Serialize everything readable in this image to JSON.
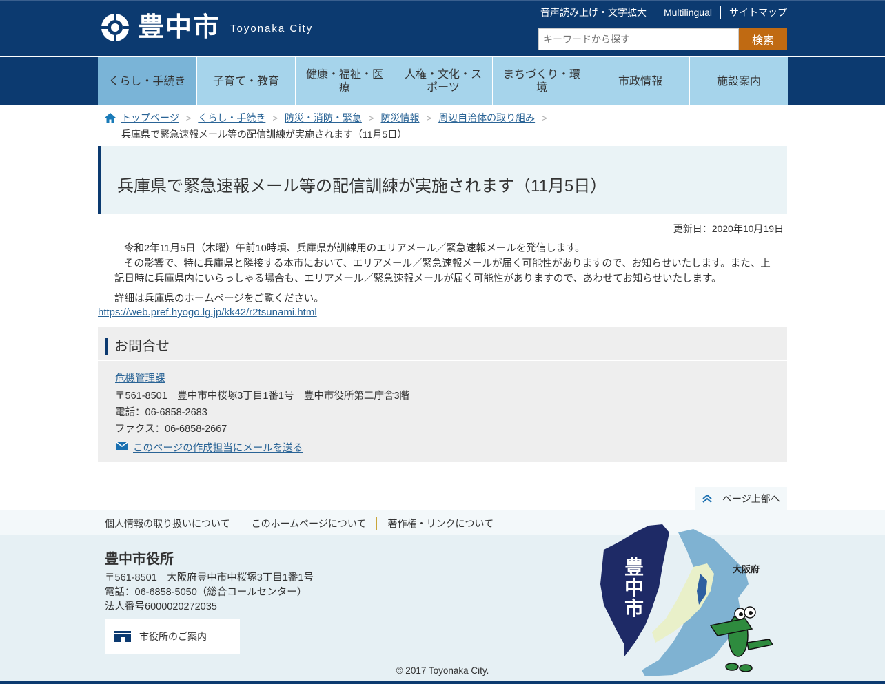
{
  "header": {
    "logo_jp": "豊中市",
    "logo_en": "Toyonaka City",
    "util_links": [
      "音声読み上げ・文字拡大",
      "Multilingual",
      "サイトマップ"
    ],
    "search_placeholder": "キーワードから探す",
    "search_button": "検索"
  },
  "nav": [
    "くらし・手続き",
    "子育て・教育",
    "健康・福祉・医療",
    "人権・文化・スポーツ",
    "まちづくり・環境",
    "市政情報",
    "施設案内"
  ],
  "breadcrumb": {
    "items": [
      "トップページ",
      "くらし・手続き",
      "防災・消防・緊急",
      "防災情報",
      "周辺自治体の取り組み"
    ],
    "current": "兵庫県で緊急速報メール等の配信訓練が実施されます（11月5日）"
  },
  "page": {
    "title": "兵庫県で緊急速報メール等の配信訓練が実施されます（11月5日）",
    "updated": "更新日：2020年10月19日",
    "para1": "令和2年11月5日（木曜）午前10時頃、兵庫県が訓練用のエリアメール／緊急速報メールを発信します。",
    "para2": "その影響で、特に兵庫県と隣接する本市において、エリアメール／緊急速報メールが届く可能性がありますので、お知らせいたします。また、上記日時に兵庫県内にいらっしゃる場合も、エリアメール／緊急速報メールが届く可能性がありますので、あわせてお知らせいたします。",
    "para3": "詳細は兵庫県のホームページをご覧ください。",
    "link": "https://web.pref.hyogo.lg.jp/kk42/r2tsunami.html"
  },
  "contact": {
    "heading": "お問合せ",
    "dept": "危機管理課",
    "address": "〒561-8501　豊中市中桜塚3丁目1番1号　豊中市役所第二庁舎3階",
    "tel": "電話：06-6858-2683",
    "fax": "ファクス：06-6858-2667",
    "mail": "このページの作成担当にメールを送る"
  },
  "pagetop": "ページ上部へ",
  "footer": {
    "links": [
      "個人情報の取り扱いについて",
      "このホームページについて",
      "著作権・リンクについて"
    ],
    "name": "豊中市役所",
    "address": "〒561-8501　大阪府豊中市中桜塚3丁目1番1号",
    "tel": "電話：06-6858-5050（総合コールセンター）",
    "corp": "法人番号6000020272035",
    "guide_button": "市役所のご案内",
    "copyright": "© 2017 Toyonaka City.",
    "map_city": "豊中市",
    "map_pref": "大阪府"
  },
  "colors": {
    "navy": "#0c3a70",
    "nav_bg": "#a6d4eb",
    "nav_active": "#7ab4d7",
    "search_btn": "#c06a12",
    "link": "#2a6496"
  }
}
